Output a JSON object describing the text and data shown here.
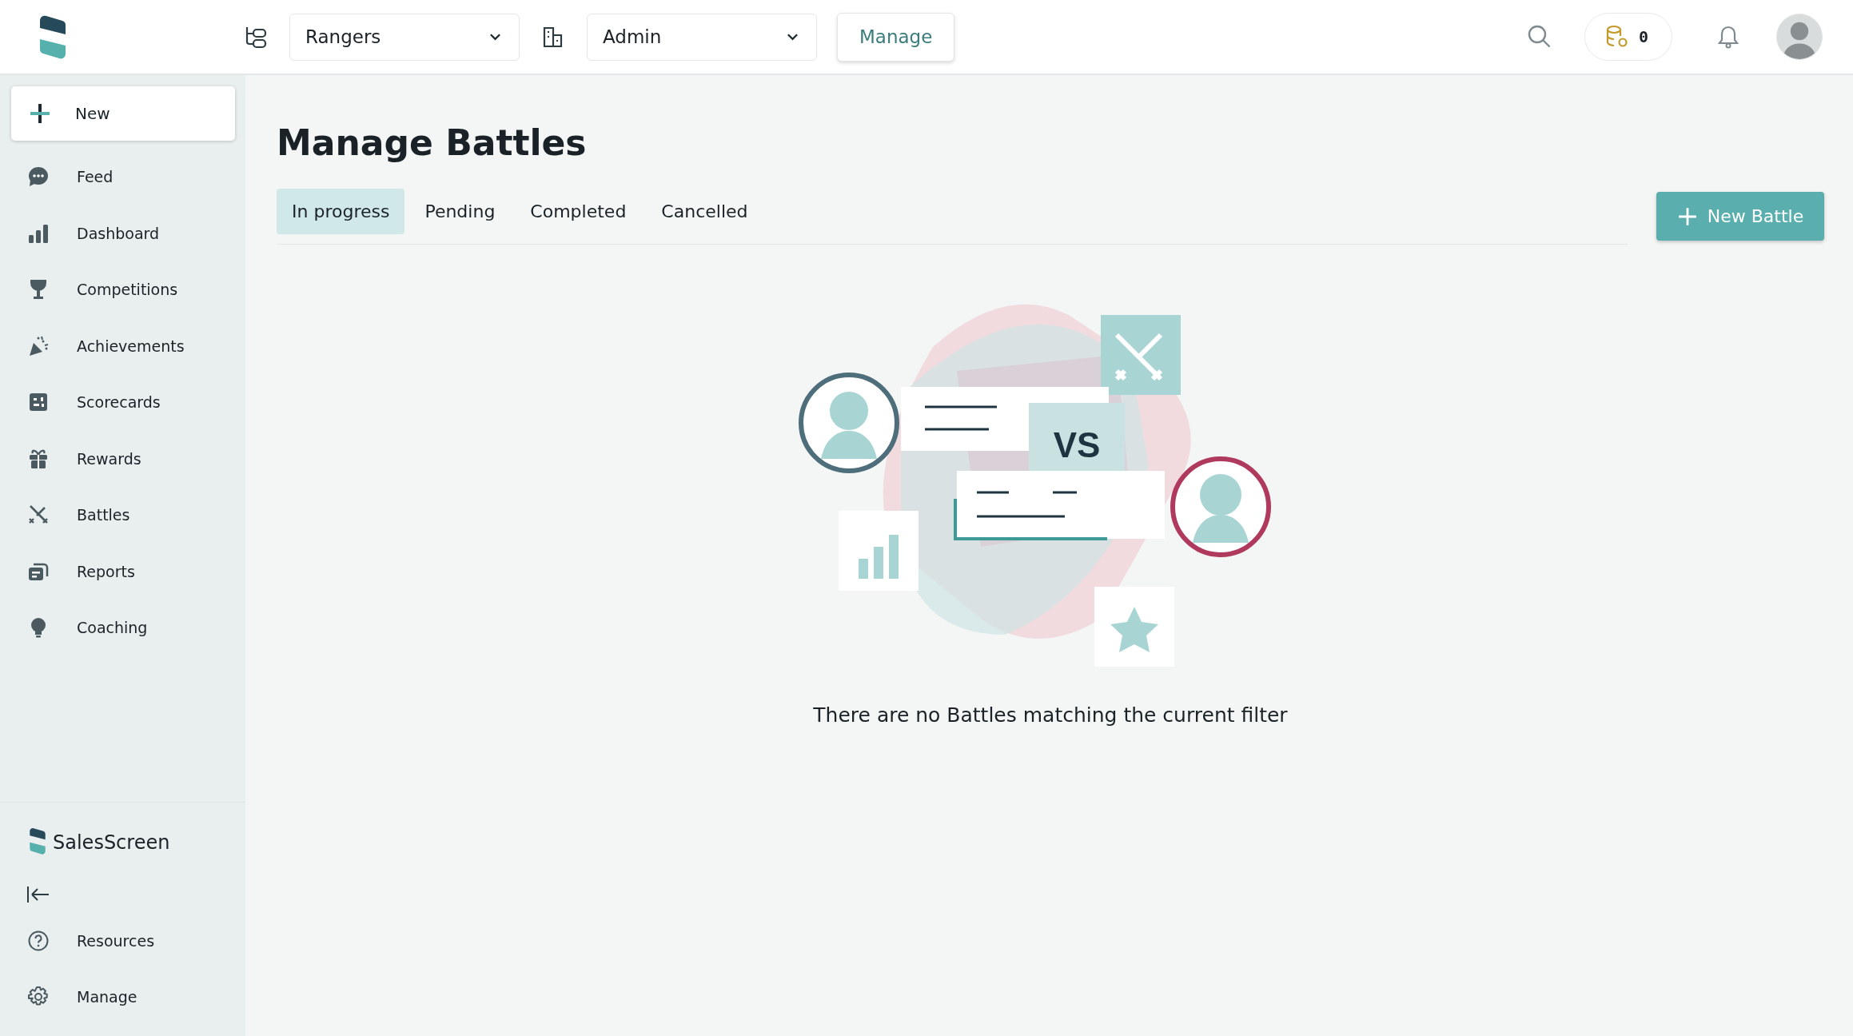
{
  "topbar": {
    "team_select": {
      "value": "Rangers"
    },
    "role_select": {
      "value": "Admin"
    },
    "manage_button": "Manage",
    "coins": "0"
  },
  "sidebar": {
    "new_button": "New",
    "items": [
      {
        "label": "Feed"
      },
      {
        "label": "Dashboard"
      },
      {
        "label": "Competitions"
      },
      {
        "label": "Achievements"
      },
      {
        "label": "Scorecards"
      },
      {
        "label": "Rewards"
      },
      {
        "label": "Battles"
      },
      {
        "label": "Reports"
      },
      {
        "label": "Coaching"
      }
    ],
    "brand": "SalesScreen",
    "footer_items": [
      {
        "label": "Resources"
      },
      {
        "label": "Manage"
      }
    ]
  },
  "page": {
    "title": "Manage Battles",
    "tabs": [
      {
        "label": "In progress",
        "selected": true
      },
      {
        "label": "Pending",
        "selected": false
      },
      {
        "label": "Completed",
        "selected": false
      },
      {
        "label": "Cancelled",
        "selected": false
      }
    ],
    "new_button": "New Battle",
    "illustration_label": "VS",
    "empty_message": "There are no Battles matching the current filter"
  }
}
